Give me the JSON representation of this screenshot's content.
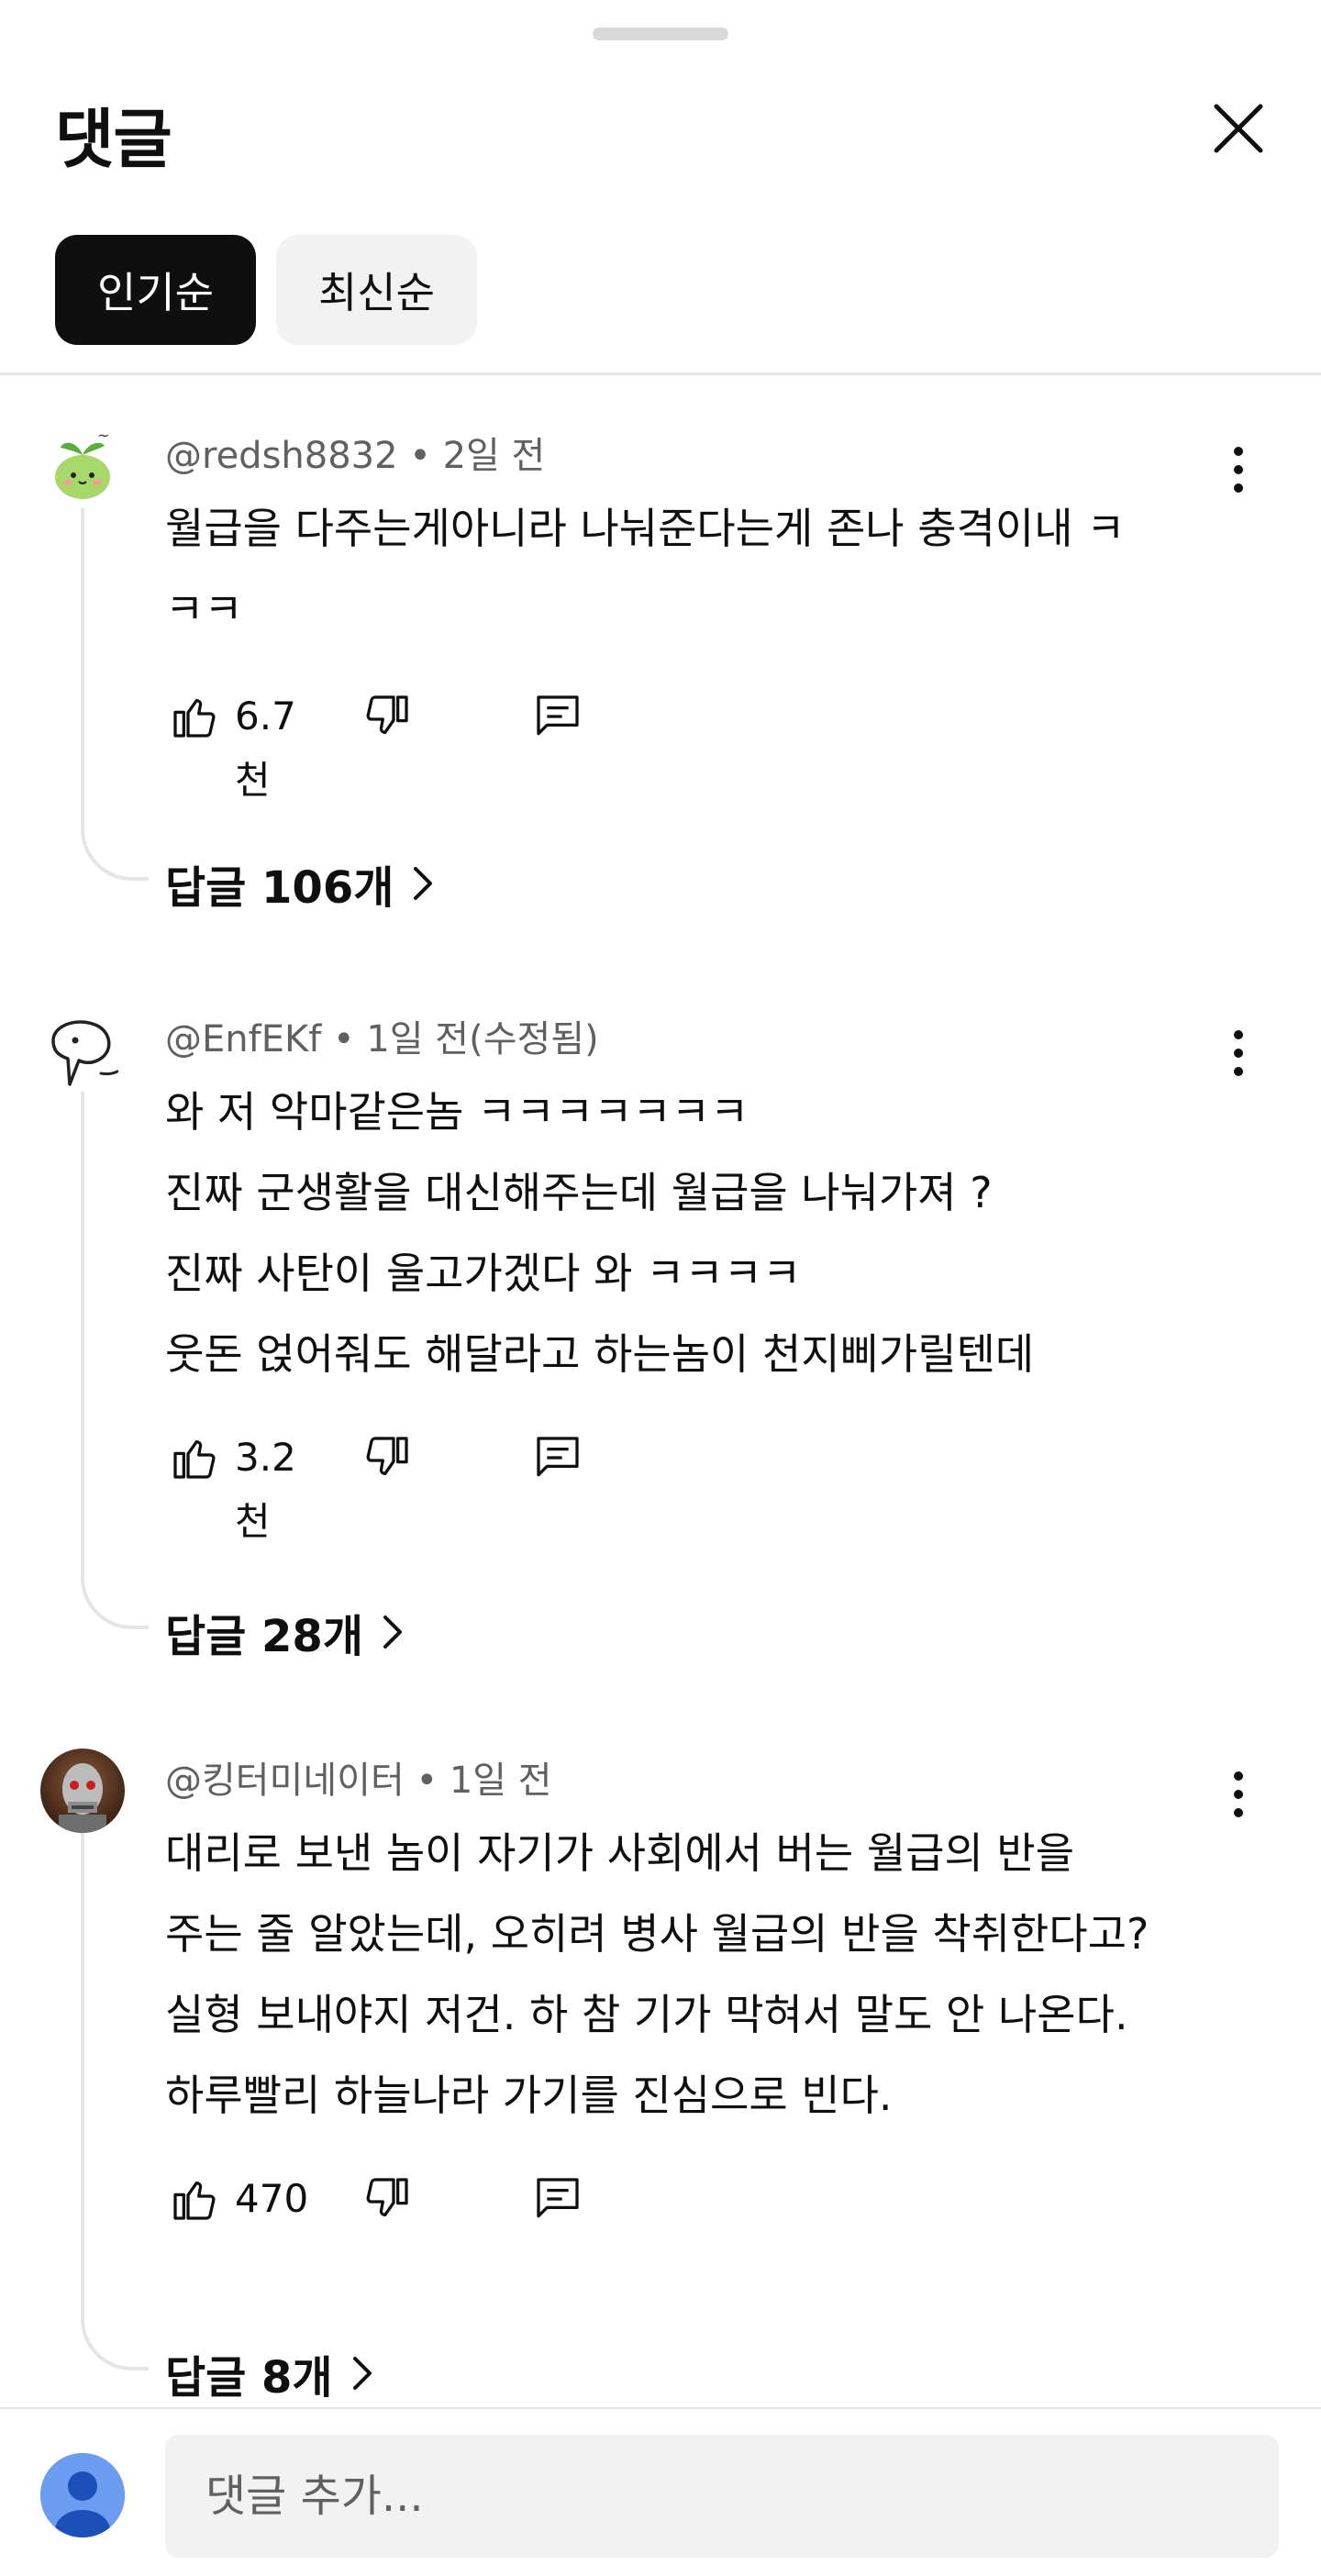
{
  "header": {
    "title": "댓글"
  },
  "sort_chips": [
    {
      "label": "인기순",
      "active": true
    },
    {
      "label": "최신순",
      "active": false
    }
  ],
  "comments": [
    {
      "author": "@redsh8832",
      "time": "2일 전",
      "body_lines": [
        "월급을 다주는게아니라 나눠준다는게 존나 충격이내 ㅋ",
        "ㅋㅋ"
      ],
      "likes": "6.7천",
      "replies": "답글 106개"
    },
    {
      "author": "@EnfEKf",
      "time": "1일 전(수정됨)",
      "body_lines": [
        "와 저 악마같은놈 ㅋㅋㅋㅋㅋㅋㅋ",
        "진짜 군생활을 대신해주는데 월급을 나눠가져 ?",
        "진짜 사탄이 울고가겠다 와 ㅋㅋㅋㅋ",
        "웃돈 얹어줘도 해달라고 하는놈이 천지삐가릴텐데"
      ],
      "likes": "3.2천",
      "replies": "답글 28개"
    },
    {
      "author": "@킹터미네이터",
      "time": "1일 전",
      "body_lines": [
        "대리로 보낸 놈이 자기가 사회에서 버는 월급의 반을",
        "주는 줄 알았는데, 오히려 병사 월급의 반을 착취한다고?",
        "실형 보내야지 저건. 하 참 기가 막혀서 말도 안 나온다.",
        "하루빨리 하늘나라 가기를 진심으로 빈다."
      ],
      "likes": "470",
      "replies": "답글 8개"
    }
  ],
  "separator": " • ",
  "input": {
    "placeholder": "댓글 추가..."
  },
  "icons": {
    "close": "close-icon",
    "more": "more-vert-icon",
    "like": "thumb-up-icon",
    "dislike": "thumb-down-icon",
    "reply": "reply-icon",
    "chevron": "chevron-right-icon"
  },
  "colors": {
    "primary_text": "#0f0f0f",
    "secondary_text": "#606060",
    "chip_active_bg": "#0f0f0f",
    "chip_bg": "#f2f2f2"
  }
}
